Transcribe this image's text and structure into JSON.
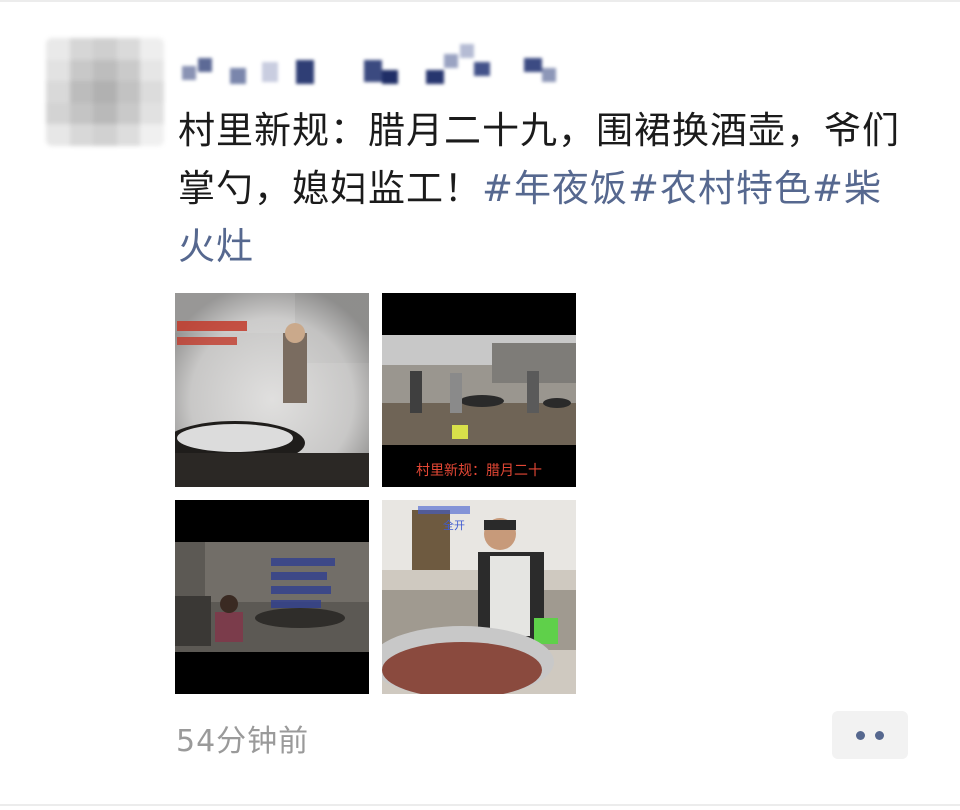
{
  "post": {
    "text": "村里新规：腊月二十九，围裙换酒壶，爷们掌勺，媳妇监工！",
    "tags": [
      "#年夜饭",
      "#农村特色",
      "#柴火灶"
    ],
    "time": "54分钟前"
  },
  "photos": [
    {
      "overlay_text": "",
      "description": "steaming wok over wood stove"
    },
    {
      "overlay_text": "村里新规：腊月二十",
      "description": "men cooking outdoors with large woks"
    },
    {
      "overlay_text": "",
      "description": "man crouching by stove in dark kitchen"
    },
    {
      "overlay_text": "全开",
      "description": "man in apron with pot of meat"
    }
  ],
  "colors": {
    "tag": "#56688f",
    "text": "#1b1b1b",
    "time": "#9a9a9a",
    "more_button_bg": "#f2f2f2"
  },
  "icons": {
    "more": "more-dots-icon"
  }
}
